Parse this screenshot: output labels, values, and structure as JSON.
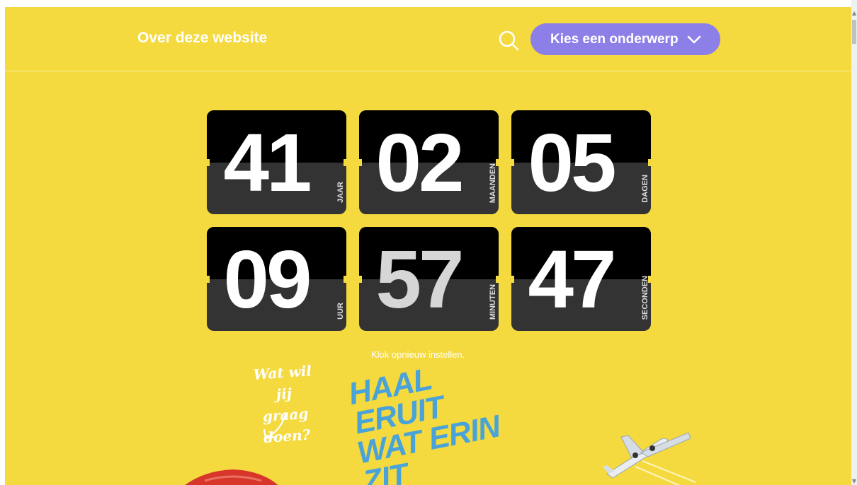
{
  "header": {
    "site_link": "Over deze website",
    "search_icon": "search-icon",
    "topic_button_label": "Kies een onderwerp",
    "topic_button_icon": "chevron-down-icon"
  },
  "countdown": {
    "cards": [
      {
        "value": "41",
        "unit": "JAAR"
      },
      {
        "value": "02",
        "unit": "MAANDEN"
      },
      {
        "value": "05",
        "unit": "DAGEN"
      },
      {
        "value": "09",
        "unit": "UUR"
      },
      {
        "value": "57",
        "unit": "MINUTEN"
      },
      {
        "value": "47",
        "unit": "SECONDEN"
      }
    ],
    "reset_link": "Klok opnieuw instellen."
  },
  "promo": {
    "handwritten_line1": "Wat wil jij",
    "handwritten_line2": "graag doen?",
    "slogan_line1": "HAAL ERUIT",
    "slogan_line2": "WAT ERIN ZIT"
  },
  "colors": {
    "background": "#f4da3e",
    "button": "#8d7fe8",
    "card_top": "#000000",
    "card_bottom": "#333333",
    "slogan": "#4aa3d8"
  }
}
